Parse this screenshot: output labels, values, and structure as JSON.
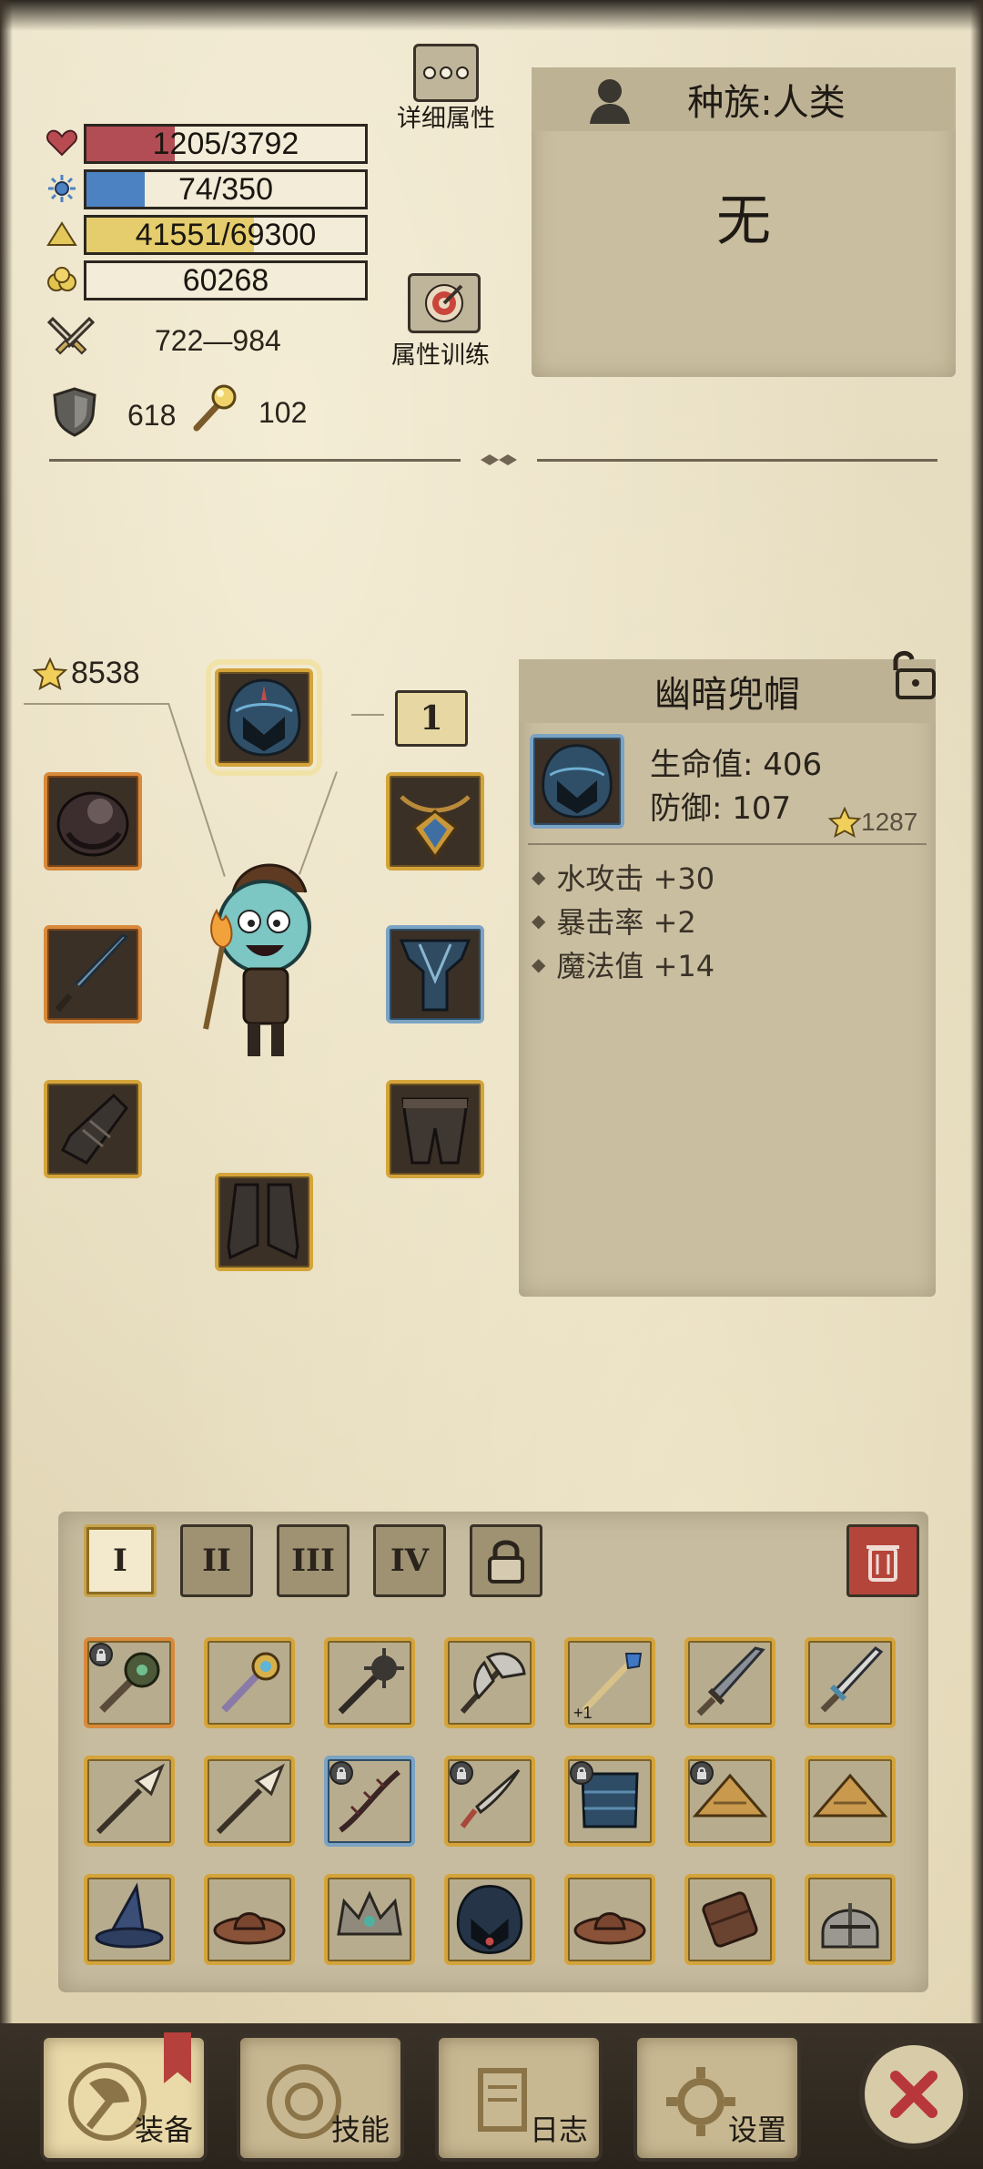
{
  "stats": {
    "hp": {
      "text": "1205/3792",
      "fraction": 0.318,
      "color": "#b24d56",
      "icon": "heart-icon"
    },
    "mana": {
      "text": "74/350",
      "fraction": 0.21,
      "color": "#4c82c2",
      "icon": "mana-icon"
    },
    "exp": {
      "text": "41551/69300",
      "fraction": 0.6,
      "color": "#e5cd6d",
      "icon": "exp-icon"
    },
    "gold": {
      "text": "60268",
      "icon": "gold-icon"
    },
    "attack": "722—984",
    "defense": "618",
    "magic": "102"
  },
  "buttons": {
    "detail_attributes": "详细属性",
    "attribute_training": "属性训练"
  },
  "race": {
    "label": "种族:人类",
    "value": "无"
  },
  "equipment": {
    "power": "8538",
    "level_badge": "1"
  },
  "detail": {
    "title": "幽暗兜帽",
    "hp_line": "生命值: 406",
    "defense_line": "防御: 107",
    "rating": "1287",
    "bonuses": [
      "水攻击 +30",
      "暴击率 +2",
      "魔法值 +14"
    ]
  },
  "inventory": {
    "tabs": [
      "I",
      "II",
      "III",
      "IV"
    ],
    "active_tab": "I",
    "plus_badge": "+1"
  },
  "nav": {
    "equipment": "装备",
    "skills": "技能",
    "journal": "日志",
    "settings": "设置"
  },
  "colors": {
    "gold_border": "#d4a43a",
    "blue_border": "#7ba3c4",
    "orange_border": "#d8893a",
    "danger": "#b4453a"
  }
}
